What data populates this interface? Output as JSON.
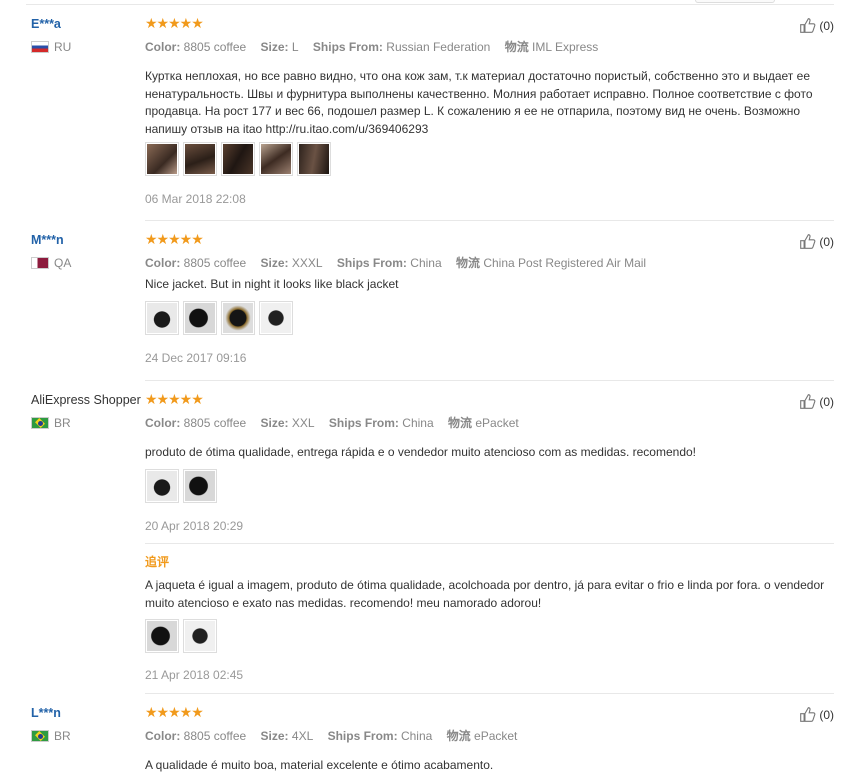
{
  "labels": {
    "color": "Color:",
    "size": "Size:",
    "ships_from": "Ships From:",
    "shipping": "物流"
  },
  "reviews": [
    {
      "user": "E***a",
      "country": "RU",
      "stars": "★★★★★",
      "likes": "(0)",
      "color": "8805 coffee",
      "size": "L",
      "ships_from": "Russian Federation",
      "shipping": "IML Express",
      "text": "Куртка неплохая, но все равно видно, что она кож зам, т.к материал достаточно пористый, собственно это и выдает ее ненатуральность. Швы и фурнитура выполнены качественно. Молния работает исправно. Полное соответствие с фото продавца. На рост 177 и вес 66, подошел размер L. К сожалению я ее не отпарила, поэтому вид не очень. Возможно напишу отзыв на itao http://ru.itao.com/u/369406293",
      "date": "06 Mar 2018 22:08"
    },
    {
      "user": "M***n",
      "country": "QA",
      "stars": "★★★★★",
      "likes": "(0)",
      "color": "8805 coffee",
      "size": "XXXL",
      "ships_from": "China",
      "shipping": "China Post Registered Air Mail",
      "text": "Nice jacket. But in night it looks like black jacket",
      "date": "24 Dec 2017 09:16"
    },
    {
      "user": "AliExpress Shopper",
      "country": "BR",
      "stars": "★★★★★",
      "likes": "(0)",
      "color": "8805 coffee",
      "size": "XXL",
      "ships_from": "China",
      "shipping": "ePacket",
      "text": "produto de ótima qualidade, entrega rápida e o vendedor muito atencioso com as medidas. recomendo!",
      "date": "20 Apr 2018 20:29",
      "followup_label": "追评",
      "followup_text": "A jaqueta é igual a imagem, produto de ótima qualidade, acolchoada por dentro, já para evitar o frio e linda por fora. o vendedor muito atencioso e exato nas medidas. recomendo! meu namorado adorou!",
      "followup_date": "21 Apr 2018 02:45"
    },
    {
      "user": "L***n",
      "country": "BR",
      "stars": "★★★★★",
      "likes": "(0)",
      "color": "8805 coffee",
      "size": "4XL",
      "ships_from": "China",
      "shipping": "ePacket",
      "text": "A qualidade é muito boa, material excelente e ótimo acabamento."
    }
  ]
}
